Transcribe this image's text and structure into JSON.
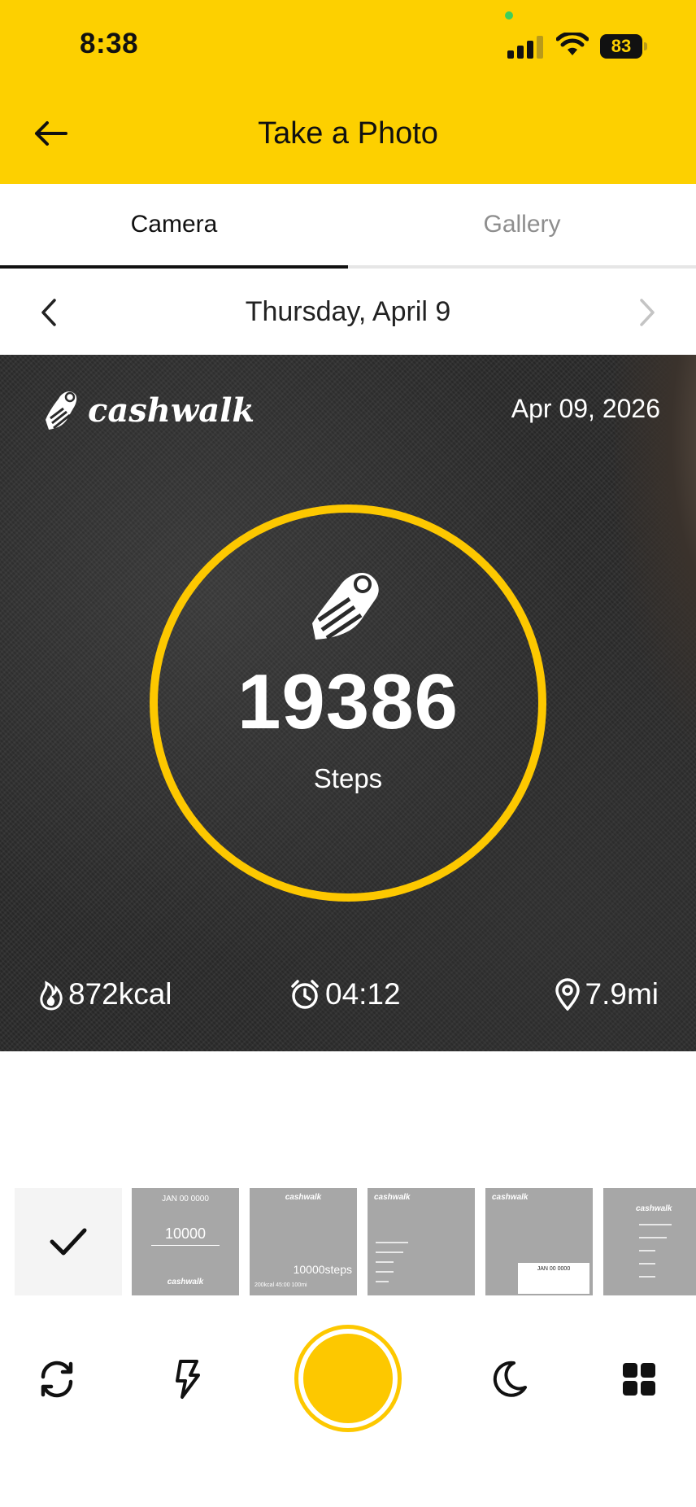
{
  "status_bar": {
    "time": "8:38",
    "battery": "83"
  },
  "header": {
    "title": "Take a Photo"
  },
  "tabs": [
    {
      "label": "Camera",
      "active": true
    },
    {
      "label": "Gallery",
      "active": false
    }
  ],
  "date_nav": {
    "label": "Thursday, April 9"
  },
  "photo": {
    "brand": "cashwalk",
    "date": "Apr 09, 2026",
    "steps_value": "19386",
    "steps_label": "Steps",
    "calories": "872kcal",
    "duration": "04:12",
    "distance": "7.9mi"
  },
  "thumbnails": [
    {
      "id": "template-1",
      "selected": true
    },
    {
      "id": "template-2",
      "big_text": "10000",
      "small_text": "JAN 00 0000",
      "brand": "cashwalk"
    },
    {
      "id": "template-3",
      "big_text": "10000steps",
      "brand": "cashwalk",
      "bottom_text": "200kcal   45:00   100mi"
    },
    {
      "id": "template-4",
      "brand": "cashwalk"
    },
    {
      "id": "template-5",
      "brand": "cashwalk",
      "card_text": "JAN 00 0000"
    },
    {
      "id": "template-6",
      "brand": "cashwalk"
    }
  ],
  "colors": {
    "accent": "#FDD000",
    "ring": "#FDC800",
    "photo_bg": "#2b2b2b"
  },
  "icons": [
    "back-arrow-icon",
    "chevron-left-icon",
    "chevron-right-icon",
    "shoe-icon",
    "flame-icon",
    "alarm-clock-icon",
    "location-pin-icon",
    "checkmark-icon",
    "flip-camera-icon",
    "flash-icon",
    "night-mode-icon",
    "grid-icon"
  ]
}
